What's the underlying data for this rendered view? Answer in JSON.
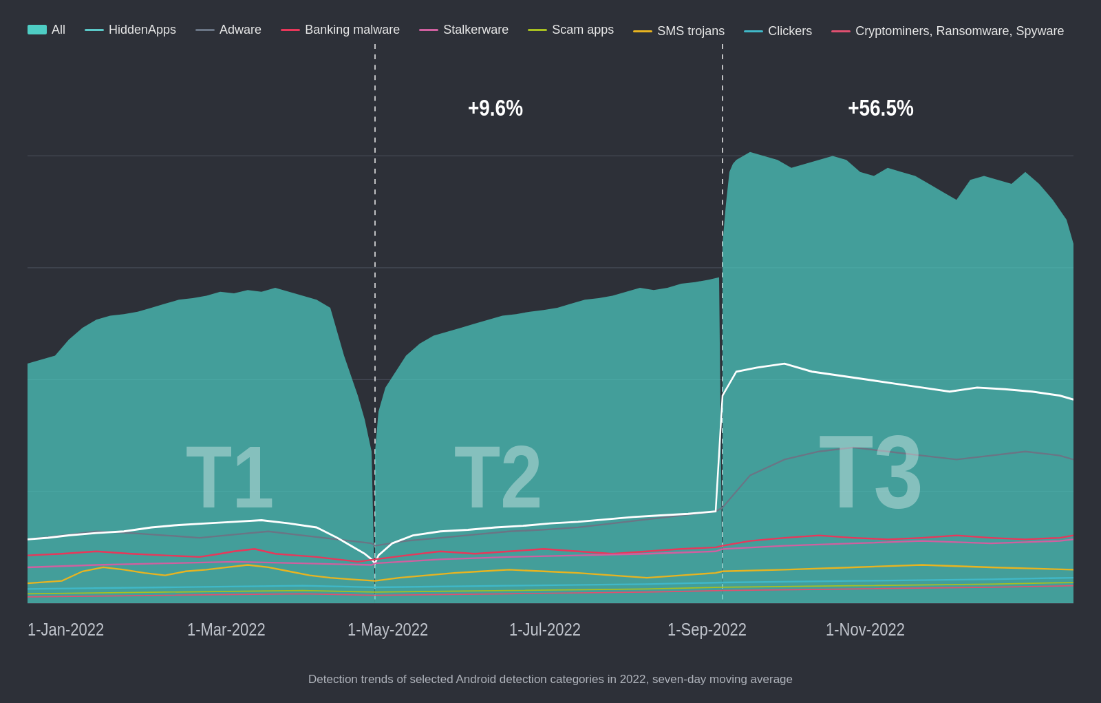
{
  "legend": {
    "row1": [
      {
        "label": "All",
        "color": "#4ecdc4",
        "type": "area"
      },
      {
        "label": "HiddenApps",
        "color": "#5bc8c8",
        "type": "line"
      },
      {
        "label": "Adware",
        "color": "#3a3f4a",
        "type": "line",
        "stroke": "#555e6e"
      },
      {
        "label": "Banking malware",
        "color": "#e8375a",
        "type": "line"
      },
      {
        "label": "Stalkerware",
        "color": "#d63f8c",
        "type": "line"
      },
      {
        "label": "Scam apps",
        "color": "#a8c020",
        "type": "line"
      }
    ],
    "row2": [
      {
        "label": "SMS trojans",
        "color": "#e8b420",
        "type": "line"
      },
      {
        "label": "Clickers",
        "color": "#40b8c8",
        "type": "line"
      },
      {
        "label": "Cryptominers, Ransomware, Spyware",
        "color": "#e05070",
        "type": "line"
      }
    ]
  },
  "annotations": {
    "t1": "T1",
    "t2": "T2",
    "t3": "T3",
    "pct1": "+9.6%",
    "pct2": "+56.5%"
  },
  "xaxis": {
    "labels": [
      "1-Jan-2022",
      "1-Mar-2022",
      "1-May-2022",
      "1-Jul-2022",
      "1-Sep-2022",
      "1-Nov-2022"
    ]
  },
  "subtitle": "Detection trends of selected Android detection categories in 2022, seven-day moving average",
  "chart": {
    "colors": {
      "all_fill": "#4ecdc4",
      "adware": "#6a7585",
      "banking": "#e8375a",
      "stalkerware": "#d060a0",
      "hidden": "#5bc4c0",
      "scam": "#a8c020",
      "sms": "#e8b420",
      "clickers": "#40b8c8",
      "crypto": "#e05070",
      "white_line": "#ffffff"
    }
  }
}
